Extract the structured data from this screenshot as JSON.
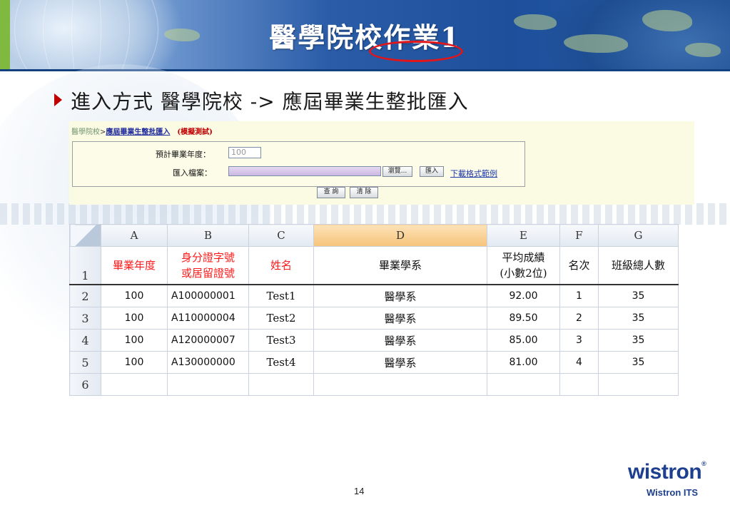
{
  "slide": {
    "title": "醫學院校作業1",
    "bullet": "進入方式 醫學院校 -> 應屆畢業生整批匯入",
    "page_number": "14"
  },
  "web_form": {
    "breadcrumb_root": "醫學院校",
    "breadcrumb_sep": ">",
    "breadcrumb_page": "應屆畢業生整批匯入",
    "breadcrumb_mode": "(模擬測試)",
    "year_label": "預計畢業年度：",
    "year_value": "100",
    "file_label": "匯入檔案：",
    "browse_button": "瀏覽...",
    "import_button": "匯入",
    "download_link": "下載格式範例",
    "query_button": "查 詢",
    "clear_button": "清 除"
  },
  "spreadsheet": {
    "columns": [
      "A",
      "B",
      "C",
      "D",
      "E",
      "F",
      "G"
    ],
    "selected_column": "D",
    "row_numbers": [
      "1",
      "2",
      "3",
      "4",
      "5",
      "6"
    ],
    "headers": {
      "a": "畢業年度",
      "b_line1": "身分證字號",
      "b_line2": "或居留證號",
      "c": "姓名",
      "d": "畢業學系",
      "e_line1": "平均成績",
      "e_line2": "(小數2位)",
      "f": "名次",
      "g": "班級總人數"
    },
    "rows": [
      {
        "year": "100",
        "id": "A100000001",
        "name": "Test1",
        "dept": "醫學系",
        "avg": "92.00",
        "rank": "1",
        "total": "35"
      },
      {
        "year": "100",
        "id": "A110000004",
        "name": "Test2",
        "dept": "醫學系",
        "avg": "89.50",
        "rank": "2",
        "total": "35"
      },
      {
        "year": "100",
        "id": "A120000007",
        "name": "Test3",
        "dept": "醫學系",
        "avg": "85.00",
        "rank": "3",
        "total": "35"
      },
      {
        "year": "100",
        "id": "A130000000",
        "name": "Test4",
        "dept": "醫學系",
        "avg": "81.00",
        "rank": "4",
        "total": "35"
      }
    ]
  },
  "logo": {
    "name": "wistron",
    "reg": "®",
    "sub": "Wistron ITS"
  },
  "colors": {
    "banner_blue": "#1d4f9b",
    "accent_red": "#c00000",
    "highlight_oval": "#e0161b",
    "logo_blue": "#1d3f8f"
  }
}
